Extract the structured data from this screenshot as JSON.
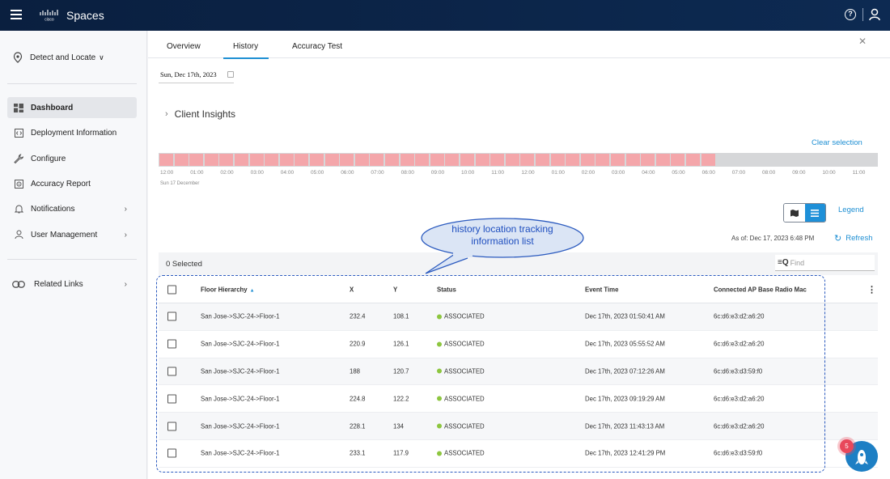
{
  "app": {
    "title": "Spaces"
  },
  "sidebar": {
    "location_selector": "Detect and Locate",
    "items": [
      {
        "label": "Dashboard",
        "icon": "dashboard-icon",
        "active": true
      },
      {
        "label": "Deployment Information",
        "icon": "code-icon"
      },
      {
        "label": "Configure",
        "icon": "wrench-icon"
      },
      {
        "label": "Accuracy Report",
        "icon": "target-icon"
      },
      {
        "label": "Notifications",
        "icon": "bell-icon",
        "has_chevron": true
      },
      {
        "label": "User Management",
        "icon": "user-icon",
        "has_chevron": true
      }
    ],
    "related_links": "Related Links"
  },
  "tabs": [
    {
      "label": "Overview"
    },
    {
      "label": "History",
      "active": true
    },
    {
      "label": "Accuracy Test"
    }
  ],
  "date_field": "Sun, Dec 17th, 2023",
  "client_insights": "Client Insights",
  "clear_selection": "Clear selection",
  "timeline": {
    "ticks": [
      "12:00",
      "01:00",
      "02:00",
      "03:00",
      "04:00",
      "05:00",
      "06:00",
      "07:00",
      "08:00",
      "09:00",
      "10:00",
      "11:00",
      "12:00",
      "01:00",
      "02:00",
      "03:00",
      "04:00",
      "05:00",
      "06:00",
      "07:00",
      "08:00",
      "09:00",
      "10:00",
      "11:00"
    ],
    "date_label": "Sun 17 December",
    "filled_slots": 37,
    "total_slots": 48,
    "fill_color": "#f4a6aa"
  },
  "view_toggle": {
    "selected": "list"
  },
  "legend_label": "Legend",
  "as_of": "As of: Dec 17, 2023 6:48 PM",
  "refresh_label": "Refresh",
  "callout_text": [
    "history location tracking",
    "information list"
  ],
  "selected_count": "0 Selected",
  "search": {
    "placeholder": "Find"
  },
  "table": {
    "columns": [
      "Floor Hierarchy",
      "X",
      "Y",
      "Status",
      "Event Time",
      "Connected AP Base Radio Mac"
    ],
    "rows": [
      [
        "San Jose->SJC-24->Floor-1",
        "232.4",
        "108.1",
        "ASSOCIATED",
        "Dec 17th, 2023 01:50:41 AM",
        "6c:d6:e3:d2:a6:20"
      ],
      [
        "San Jose->SJC-24->Floor-1",
        "220.9",
        "126.1",
        "ASSOCIATED",
        "Dec 17th, 2023 05:55:52 AM",
        "6c:d6:e3:d2:a6:20"
      ],
      [
        "San Jose->SJC-24->Floor-1",
        "188",
        "120.7",
        "ASSOCIATED",
        "Dec 17th, 2023 07:12:26 AM",
        "6c:d6:e3:d3:59:f0"
      ],
      [
        "San Jose->SJC-24->Floor-1",
        "224.8",
        "122.2",
        "ASSOCIATED",
        "Dec 17th, 2023 09:19:29 AM",
        "6c:d6:e3:d2:a6:20"
      ],
      [
        "San Jose->SJC-24->Floor-1",
        "228.1",
        "134",
        "ASSOCIATED",
        "Dec 17th, 2023 11:43:13 AM",
        "6c:d6:e3:d2:a6:20"
      ],
      [
        "San Jose->SJC-24->Floor-1",
        "233.1",
        "117.9",
        "ASSOCIATED",
        "Dec 17th, 2023 12:41:29 PM",
        "6c:d6:e3:d3:59:f0"
      ]
    ]
  },
  "notification_badge": "5",
  "colors": {
    "brand_navy": "#0b2344",
    "accent": "#1e8fd3",
    "status_ok": "#8dc63f"
  }
}
